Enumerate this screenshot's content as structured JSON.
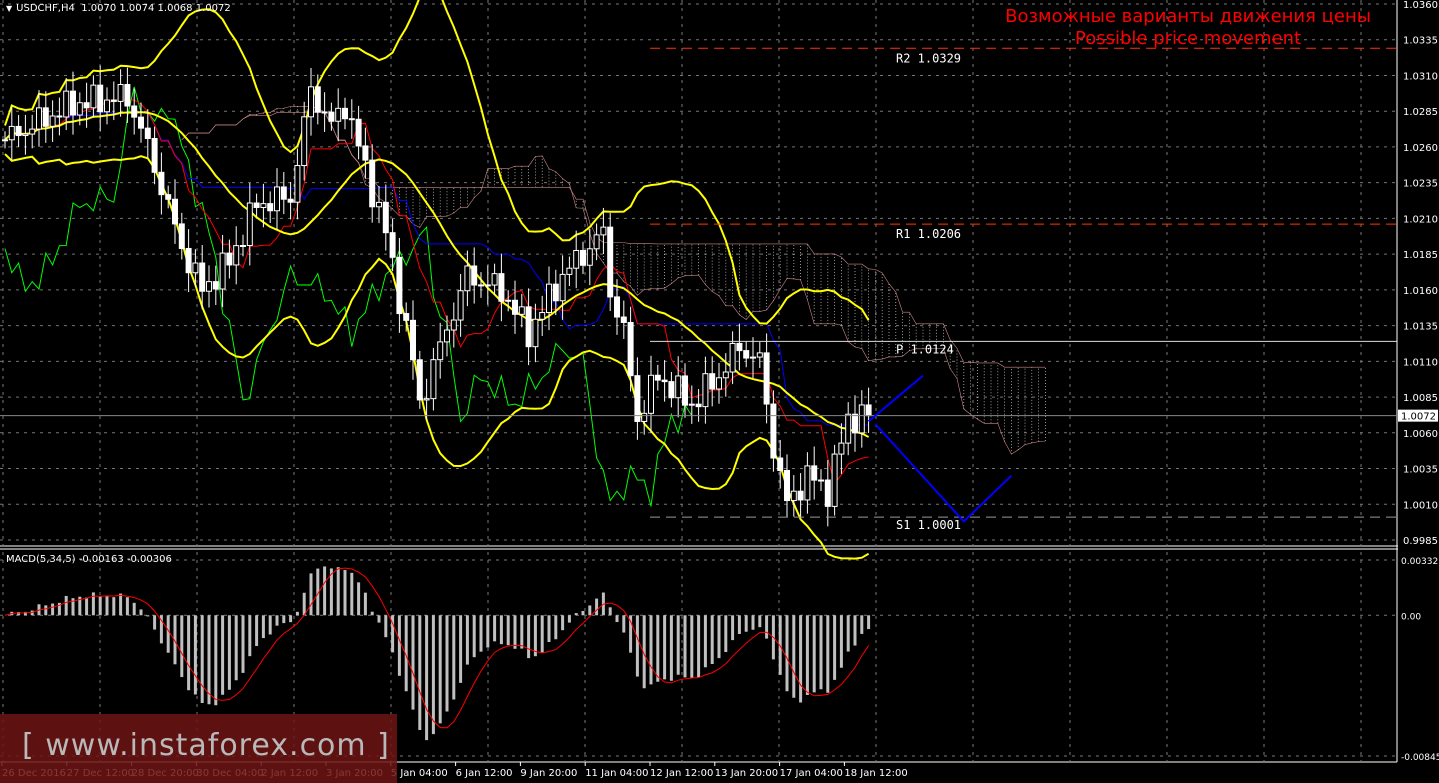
{
  "header": {
    "symbol": "USDCHF,H4",
    "ohlc": "1.0070 1.0074 1.0068 1.0072"
  },
  "annotation": {
    "line1": "Возможные варианты движения цены",
    "line2": "Possible price movement"
  },
  "watermark": "[ www.instaforex.com ]",
  "macd_header": "MACD(5,34,5) -0.00163 -0.00306",
  "colors": {
    "up": "#ffffff",
    "down": "#ffffff",
    "bb": "#ffff00",
    "tenkan": "#ff0000",
    "kijun": "#0000ff",
    "chikou": "#00ff00",
    "signal": "#ff0000",
    "hist": "#c0c0c0",
    "axis": "#ffffff",
    "level": "#ff3300",
    "forecast": "#0000ff"
  },
  "chart_data": {
    "type": "candlestick",
    "symbol": "USDCHF",
    "timeframe": "H4",
    "ylim": [
      0.9985,
      1.036
    ],
    "yticks": [
      "1.0360",
      "1.0335",
      "1.0310",
      "1.0285",
      "1.0260",
      "1.0235",
      "1.0210",
      "1.0185",
      "1.0160",
      "1.0135",
      "1.0110",
      "1.0085",
      "1.0060",
      "1.0035",
      "1.0010",
      "0.9985"
    ],
    "current_price": "1.0072",
    "xticks": [
      "26 Dec 2016",
      "27 Dec 12:00",
      "28 Dec 20:00",
      "30 Dec 04:00",
      "2 Jan 12:00",
      "3 Jan 20:00",
      "5 Jan 04:00",
      "6 Jan 12:00",
      "9 Jan 20:00",
      "11 Jan 04:00",
      "12 Jan 12:00",
      "13 Jan 20:00",
      "17 Jan 04:00",
      "18 Jan 12:00"
    ],
    "bars": 128,
    "close_path": [
      [
        0,
        1.0265
      ],
      [
        4,
        1.0275
      ],
      [
        10,
        1.029
      ],
      [
        18,
        1.0295
      ],
      [
        21,
        1.026
      ],
      [
        26,
        1.019
      ],
      [
        29,
        1.016
      ],
      [
        33,
        1.018
      ],
      [
        37,
        1.022
      ],
      [
        42,
        1.0225
      ],
      [
        45,
        1.03
      ],
      [
        48,
        1.0275
      ],
      [
        50,
        1.029
      ],
      [
        54,
        1.023
      ],
      [
        56,
        1.02
      ],
      [
        60,
        1.011
      ],
      [
        61,
        1.008
      ],
      [
        64,
        1.012
      ],
      [
        68,
        1.017
      ],
      [
        73,
        1.016
      ],
      [
        77,
        1.013
      ],
      [
        82,
        1.017
      ],
      [
        88,
        1.02
      ],
      [
        89,
        1.016
      ],
      [
        91,
        1.013
      ],
      [
        93,
        1.007
      ],
      [
        96,
        1.01
      ],
      [
        101,
        1.008
      ],
      [
        105,
        1.01
      ],
      [
        108,
        1.012
      ],
      [
        111,
        1.011
      ],
      [
        113,
        1.005
      ],
      [
        115,
        1.001
      ],
      [
        118,
        1.003
      ],
      [
        121,
        1.002
      ],
      [
        124,
        1.007
      ],
      [
        127,
        1.0072
      ]
    ],
    "levels": [
      {
        "label": "R2",
        "value": "1.0329",
        "style": "dashed-red"
      },
      {
        "label": "R1",
        "value": "1.0206",
        "style": "dashed-red"
      },
      {
        "label": "P",
        "value": "1.0124",
        "style": "solid-white"
      },
      {
        "label": "S1",
        "value": "1.0001",
        "style": "dashed-gray"
      }
    ],
    "forecast": [
      [
        [
          127,
          1.0068
        ],
        [
          135,
          1.01
        ]
      ],
      [
        [
          128,
          1.0066
        ],
        [
          141,
          0.9998
        ],
        [
          148,
          1.003
        ]
      ]
    ],
    "macd": {
      "params": "5,34,5",
      "value": "-0.00163",
      "signal": "-0.00306",
      "ylim": [
        -0.00845,
        0.00332
      ],
      "yticks": [
        "0.00332",
        "0.00",
        "-0.00845"
      ]
    }
  }
}
